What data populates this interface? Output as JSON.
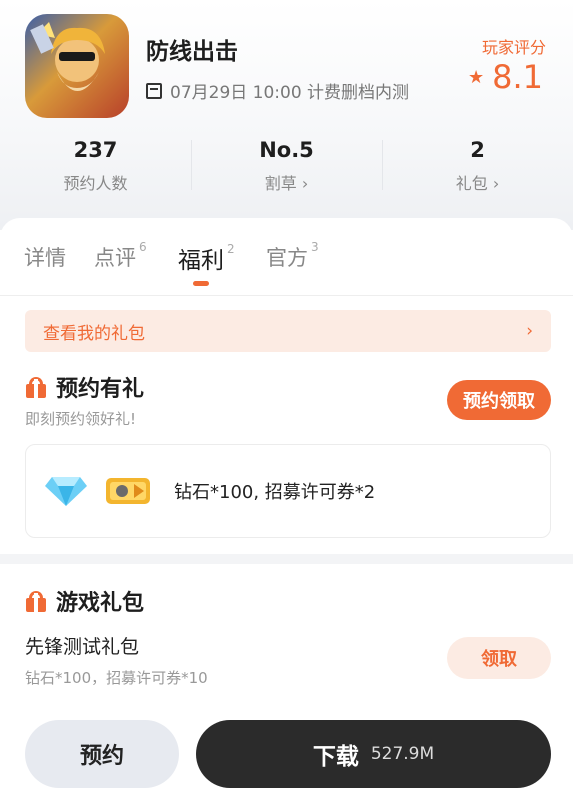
{
  "app": {
    "name": "防线出击",
    "schedule": "07月29日 10:00 计费删档内测",
    "rating_label": "玩家评分",
    "rating_value": "8.1",
    "rating_color": "#f06a35",
    "icon": "app-icon"
  },
  "stats": [
    {
      "value": "237",
      "label": "预约人数"
    },
    {
      "value": "No.5",
      "label": "割草 ›"
    },
    {
      "value": "2",
      "label": "礼包 ›"
    }
  ],
  "tabs": [
    {
      "label": "详情",
      "count": ""
    },
    {
      "label": "点评",
      "count": "6"
    },
    {
      "label": "福利",
      "count": "2"
    },
    {
      "label": "官方",
      "count": "3"
    }
  ],
  "active_tab": "福利",
  "gift_banner": {
    "label": "查看我的礼包",
    "arrow": "›"
  },
  "reserve_gift": {
    "title": "预约有礼",
    "subtitle": "即刻预约领好礼!",
    "button": "预约领取",
    "rewards": "钻石*100, 招募许可券*2",
    "icons": [
      "diamond-icon",
      "ticket-icon"
    ]
  },
  "game_gift": {
    "title": "游戏礼包",
    "pack_name": "先锋测试礼包",
    "pack_desc": "钻石*100，招募许可券*10",
    "button": "领取"
  },
  "footer": {
    "reserve_label": "预约",
    "download_label": "下载",
    "download_size": "527.9M"
  },
  "colors": {
    "accent": "#f06a35",
    "accent_light": "#fcebe3",
    "dark_button": "#2b2b2b"
  }
}
